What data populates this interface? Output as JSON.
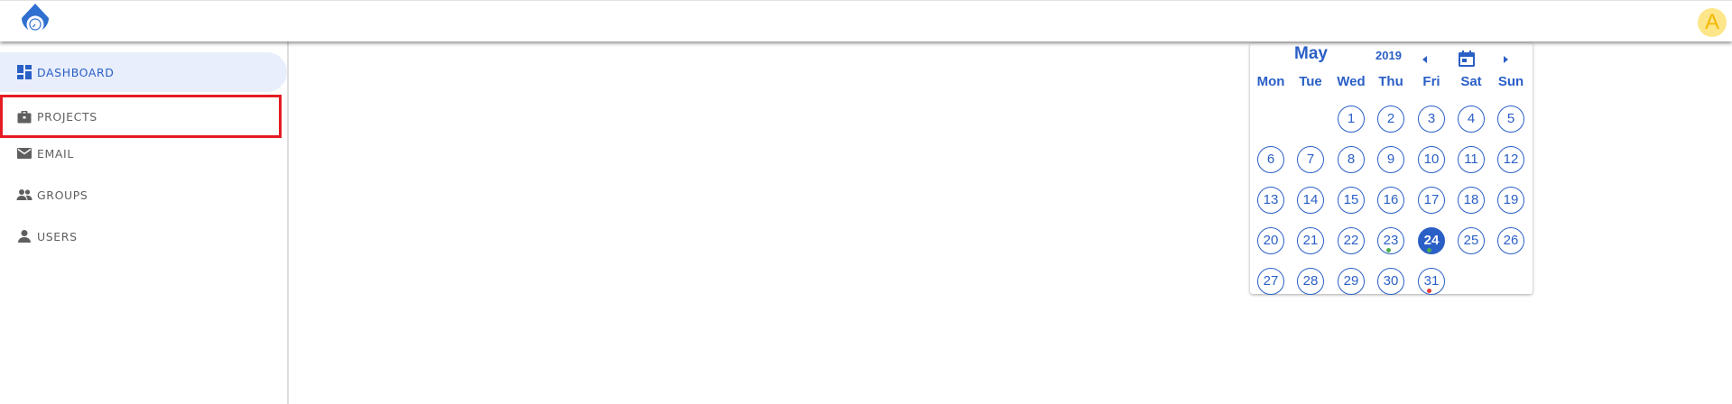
{
  "header": {
    "avatar_letter": "A"
  },
  "sidebar": {
    "items": [
      {
        "label": "DASHBOARD",
        "icon": "dashboard-icon"
      },
      {
        "label": "PROJECTS",
        "icon": "briefcase-icon"
      },
      {
        "label": "EMAIL",
        "icon": "mail-icon"
      },
      {
        "label": "GROUPS",
        "icon": "groups-icon"
      },
      {
        "label": "USERS",
        "icon": "user-icon"
      }
    ]
  },
  "calendar": {
    "month": "May",
    "year": "2019",
    "weekdays": [
      "Mon",
      "Tue",
      "Wed",
      "Thu",
      "Fri",
      "Sat",
      "Sun"
    ],
    "first_weekday_index": 2,
    "days": [
      "1",
      "2",
      "3",
      "4",
      "5",
      "6",
      "7",
      "8",
      "9",
      "10",
      "11",
      "12",
      "13",
      "14",
      "15",
      "16",
      "17",
      "18",
      "19",
      "20",
      "21",
      "22",
      "23",
      "24",
      "25",
      "26",
      "27",
      "28",
      "29",
      "30",
      "31"
    ],
    "selected_day": "24",
    "event_markers": [
      {
        "day": "23",
        "color": "#4caf50"
      },
      {
        "day": "24",
        "color": "#4caf50"
      },
      {
        "day": "31",
        "color": "#e53935"
      }
    ]
  },
  "colors": {
    "accent": "#2a5fc6",
    "selection_outline": "#e51c23",
    "avatar_bg": "#fde68a",
    "avatar_fg": "#f2b705"
  }
}
